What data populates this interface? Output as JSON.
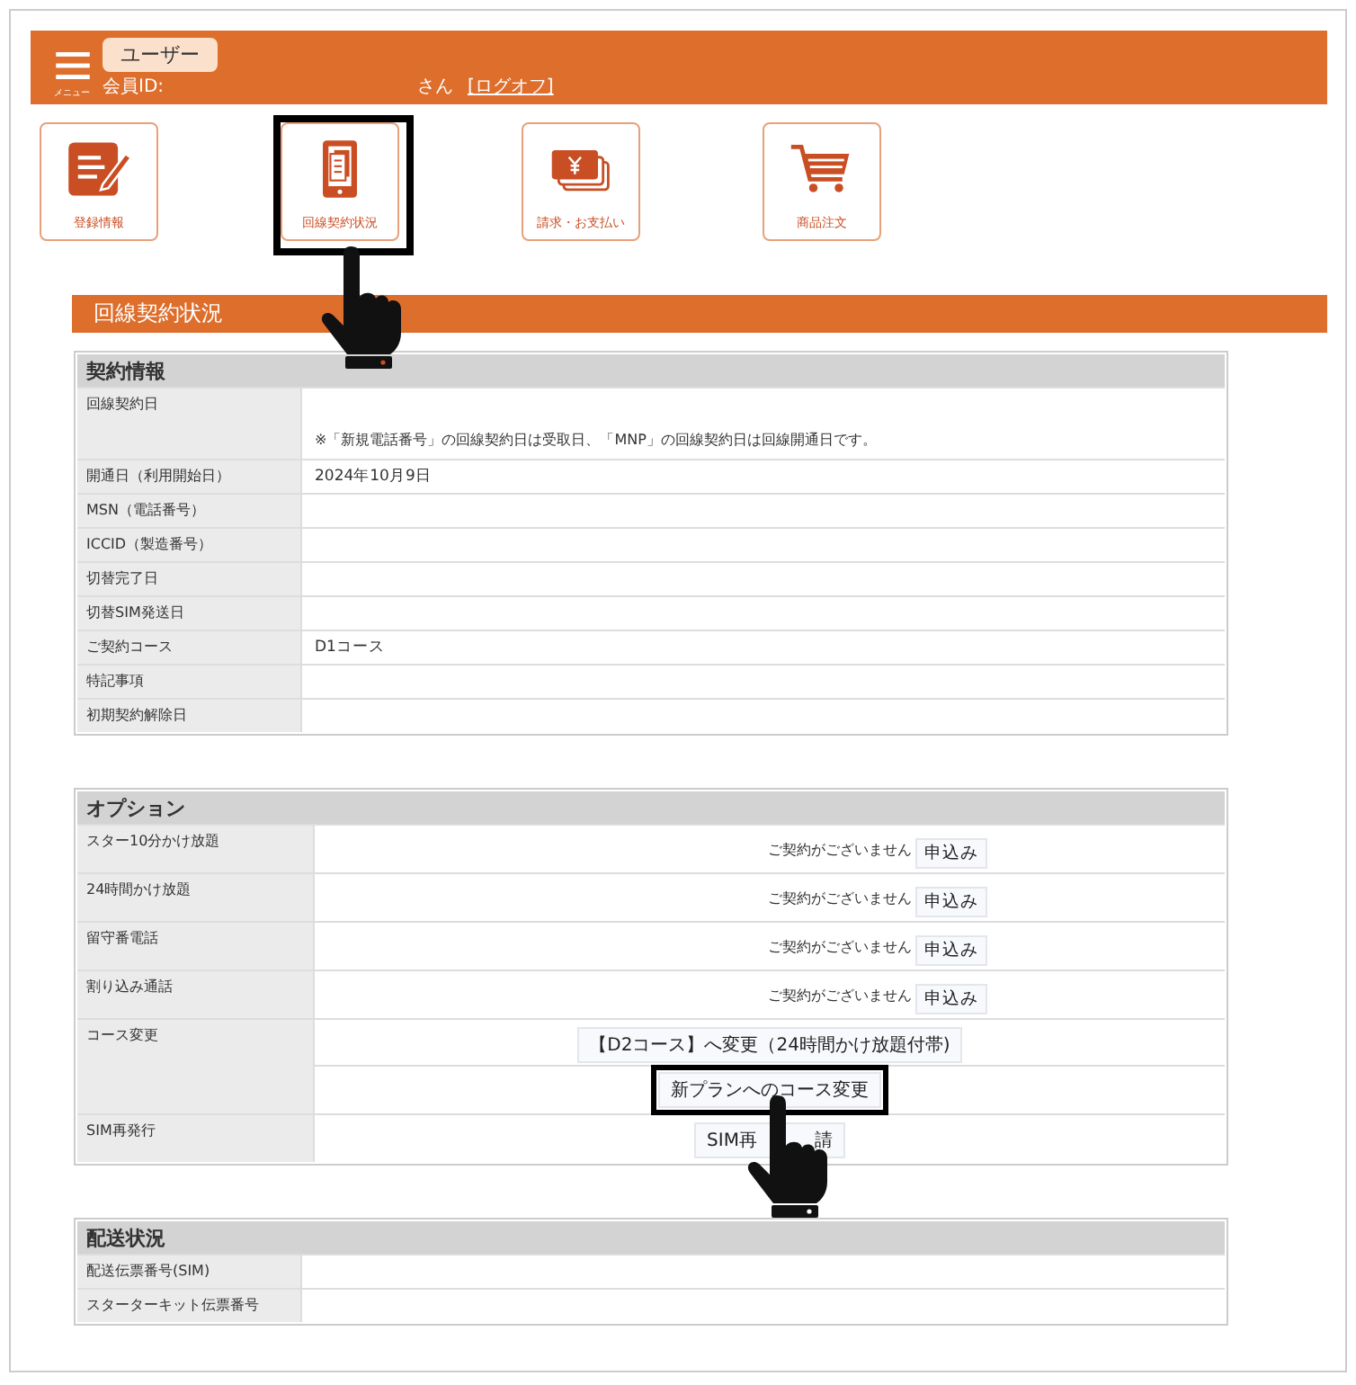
{
  "header": {
    "menu_label": "メニュー",
    "user_badge": "ユーザー",
    "member_id_label": "会員ID:",
    "honorific": "さん",
    "logout": "[ログオフ]"
  },
  "menu": [
    {
      "label": "登録情報",
      "kind": "form",
      "highlighted": false
    },
    {
      "label": "回線契約状況",
      "kind": "tablet",
      "highlighted": true
    },
    {
      "label": "請求・お支払い",
      "kind": "money",
      "highlighted": false
    },
    {
      "label": "商品注文",
      "kind": "cart",
      "highlighted": false
    }
  ],
  "section_title": "回線契約状況",
  "contract": {
    "title": "契約情報",
    "rows": [
      {
        "label": "回線契約日",
        "note": "※「新規電話番号」の回線契約日は受取日、「MNP」の回線契約日は回線開通日です。"
      },
      {
        "label": "開通日（利用開始日）",
        "value": "2024年10月9日"
      },
      {
        "label": "MSN（電話番号）"
      },
      {
        "label": "ICCID（製造番号）"
      },
      {
        "label": "切替完了日"
      },
      {
        "label": "切替SIM発送日"
      },
      {
        "label": "ご契約コース",
        "value": "D1コース"
      },
      {
        "label": "特記事項"
      },
      {
        "label": "初期契約解除日"
      }
    ]
  },
  "options": {
    "title": "オプション",
    "rows": [
      {
        "label": "スター10分かけ放題",
        "status": "ご契約がございません",
        "buttons": [
          {
            "label": "申込み",
            "highlighted": false
          }
        ]
      },
      {
        "label": "24時間かけ放題",
        "status": "ご契約がございません",
        "buttons": [
          {
            "label": "申込み",
            "highlighted": false
          }
        ]
      },
      {
        "label": "留守番電話",
        "status": "ご契約がございません",
        "buttons": [
          {
            "label": "申込み",
            "highlighted": false
          }
        ]
      },
      {
        "label": "割り込み通話",
        "status": "ご契約がございません",
        "buttons": [
          {
            "label": "申込み",
            "highlighted": false
          }
        ]
      },
      {
        "label": "コース変更",
        "buttons": [
          {
            "label": "【D2コース】へ変更（24時間かけ放題付帯)",
            "highlighted": false
          },
          {
            "label": "新プランへのコース変更",
            "highlighted": true
          }
        ]
      },
      {
        "label": "SIM再発行",
        "buttons": [
          {
            "label_parts": [
              "SIM再",
              "請"
            ],
            "highlighted": false
          }
        ]
      }
    ]
  },
  "delivery": {
    "title": "配送状況",
    "rows": [
      {
        "label": "配送伝票番号(SIM)"
      },
      {
        "label": "スターターキット伝票番号"
      }
    ]
  }
}
